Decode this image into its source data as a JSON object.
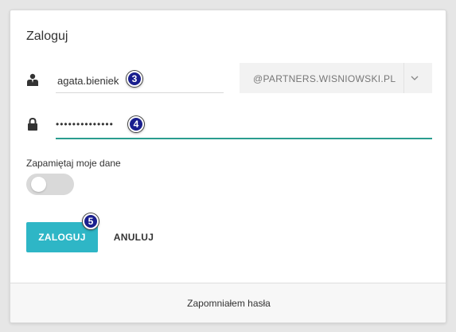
{
  "form": {
    "title": "Zaloguj",
    "username": {
      "value": "agata.bieniek",
      "icon": "user-icon"
    },
    "domain": {
      "value": "@PARTNERS.WISNIOWSKI.PL",
      "icon": "chevron-down-icon"
    },
    "password": {
      "value": "••••••••••••••",
      "icon": "lock-icon"
    },
    "remember": {
      "label": "Zapamiętaj moje dane",
      "enabled": false
    },
    "login_label": "ZALOGUJ",
    "cancel_label": "ANULUJ",
    "forgot_label": "Zapomniałem hasła"
  },
  "step_badges": [
    "3",
    "4",
    "5"
  ],
  "colors": {
    "accent": "#2eb6c6",
    "field_underline_active": "#2a9d8f",
    "badge": "#1a1f8e"
  }
}
